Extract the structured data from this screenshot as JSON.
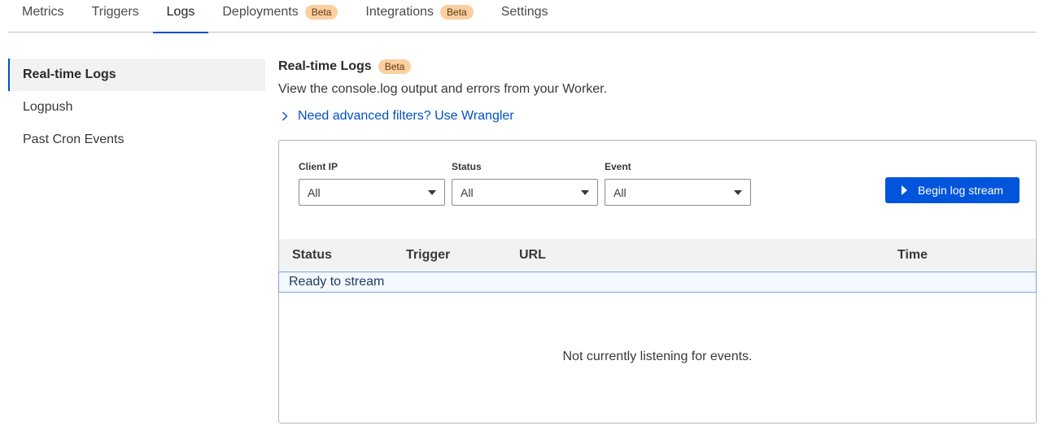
{
  "tabs": [
    {
      "label": "Metrics",
      "badge": ""
    },
    {
      "label": "Triggers",
      "badge": ""
    },
    {
      "label": "Logs",
      "badge": ""
    },
    {
      "label": "Deployments",
      "badge": "Beta"
    },
    {
      "label": "Integrations",
      "badge": "Beta"
    },
    {
      "label": "Settings",
      "badge": ""
    }
  ],
  "sidebar": {
    "items": [
      {
        "label": "Real-time Logs"
      },
      {
        "label": "Logpush"
      },
      {
        "label": "Past Cron Events"
      }
    ]
  },
  "main": {
    "title": "Real-time Logs",
    "title_badge": "Beta",
    "description": "View the console.log output and errors from your Worker.",
    "advanced_link": "Need advanced filters? Use Wrangler",
    "filters": [
      {
        "label": "Client IP",
        "value": "All"
      },
      {
        "label": "Status",
        "value": "All"
      },
      {
        "label": "Event",
        "value": "All"
      }
    ],
    "stream_button": "Begin log stream",
    "columns": [
      "Status",
      "Trigger",
      "URL",
      "Time"
    ],
    "ready_text": "Ready to stream",
    "empty_text": "Not currently listening for events."
  },
  "colors": {
    "accent": "#0051c3",
    "button": "#0055dc",
    "badge_bg": "#fbcf9f"
  }
}
